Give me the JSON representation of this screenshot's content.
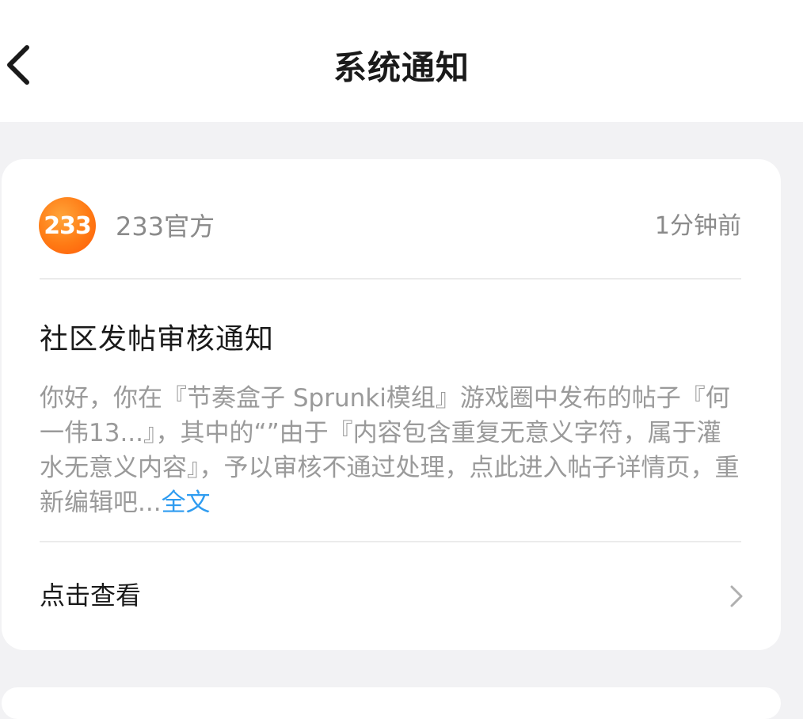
{
  "header": {
    "title": "系统通知",
    "back_icon": "chevron-left-icon"
  },
  "notification": {
    "avatar_text": "233",
    "avatar_colors": [
      "#ffa53a",
      "#ff5a0a"
    ],
    "sender": "233官方",
    "time": "1分钟前",
    "title": "社区发帖审核通知",
    "body": "你好，你在『节奏盒子 Sprunki模组』游戏圈中发布的帖子『何一伟13...』，其中的“”由于『内容包含重复无意义字符，属于灌水无意义内容』，予以审核不通过处理，点此进入帖子详情页，重新编辑吧...",
    "full_text_link": "全文",
    "link_color": "#2f9cf0",
    "action_label": "点击查看",
    "action_icon": "chevron-right-icon"
  }
}
